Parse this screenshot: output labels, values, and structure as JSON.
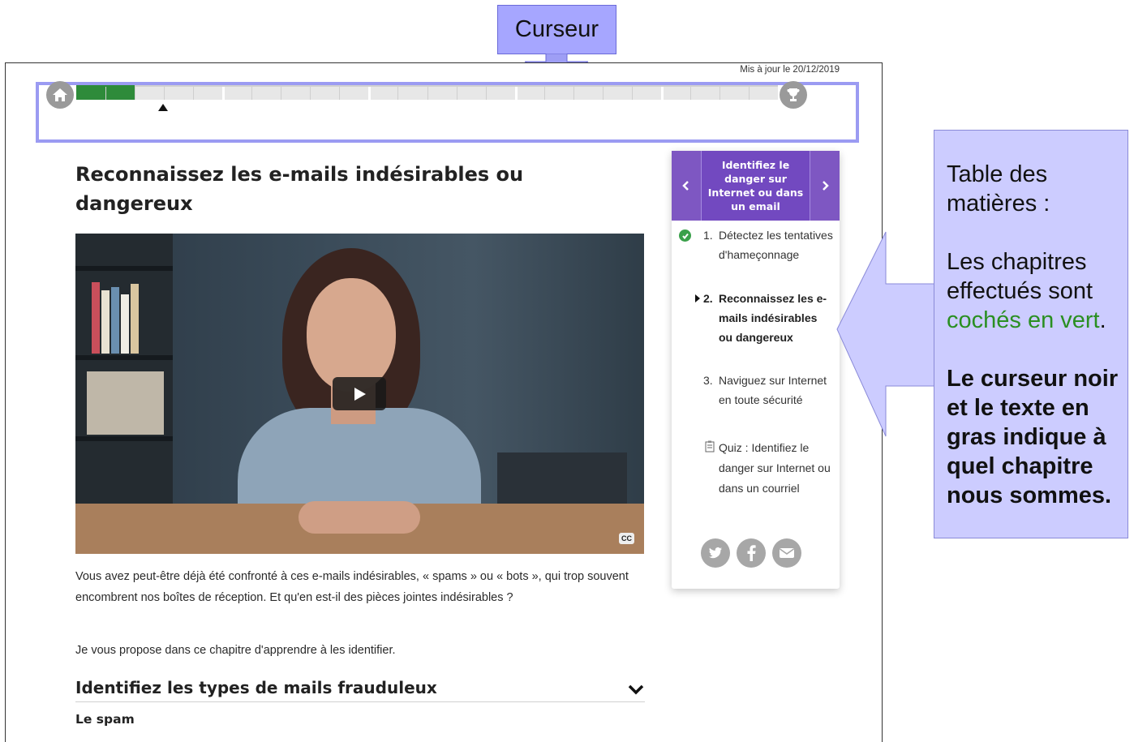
{
  "annotation_cursor": {
    "label": "Curseur"
  },
  "header": {
    "updated": "Mis à jour le 20/12/2019"
  },
  "progress": {
    "completed_fraction": 0.083,
    "segments": 24,
    "major_every": 5
  },
  "page_title": "Reconnaissez les e-mails indésirables ou dangereux",
  "video": {
    "cc_label": "CC"
  },
  "intro": {
    "paragraph1": "Vous avez peut-être déjà été confronté à ces e-mails indésirables, « spams » ou « bots », qui trop souvent encombrent nos boîtes de réception. Et qu'en est-il des pièces jointes indésirables ?",
    "paragraph2": "Je vous propose dans ce chapitre d'apprendre à les identifier."
  },
  "section": {
    "title": "Identifiez les types de mails frauduleux",
    "subtitle": "Le spam"
  },
  "toc": {
    "header": "Identifiez le danger sur Internet ou dans un email",
    "items": [
      {
        "num": "1.",
        "text": "Détectez les tentatives d'hameçonnage",
        "state": "done"
      },
      {
        "num": "2.",
        "text": "Reconnaissez les e-mails indésirables ou dangereux",
        "state": "current"
      },
      {
        "num": "3.",
        "text": "Naviguez sur Internet en toute sécurité",
        "state": "todo"
      },
      {
        "num": "",
        "text": "Quiz : Identifiez le danger sur Internet ou dans un courriel",
        "state": "quiz"
      }
    ]
  },
  "annotation_toc": {
    "line1": "Table des matières :",
    "line2a": "Les chapitres effectués sont ",
    "line2b": "cochés en vert",
    "line2c": ".",
    "line3": "Le curseur noir et le texte en gras indique à quel chapitre nous sommes."
  },
  "colors": {
    "accent_purple": "#7249c0",
    "progress_green": "#2e8b3a",
    "annotation_blue": "#ccccff"
  }
}
